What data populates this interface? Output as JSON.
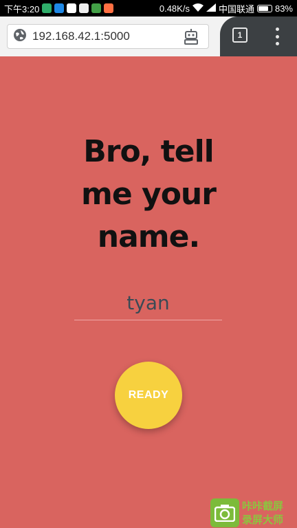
{
  "status_bar": {
    "time": "下午3:20",
    "net_speed": "0.48K/s",
    "carrier": "中国联通",
    "battery": "83%",
    "battery_level": 0.83
  },
  "browser": {
    "url": "192.168.42.1:5000",
    "tab_count": "1"
  },
  "page": {
    "headline_line1": "Bro, tell",
    "headline_line2": "me your",
    "headline_line3": "name.",
    "name_value": "tyan",
    "ready_label": "READY"
  },
  "watermark": {
    "line1": "咔咔截屏",
    "line2": "录屏大师"
  },
  "colors": {
    "background": "#d9645f",
    "button": "#f7d13f",
    "headline": "#111111",
    "input_text": "#3a4a55"
  }
}
